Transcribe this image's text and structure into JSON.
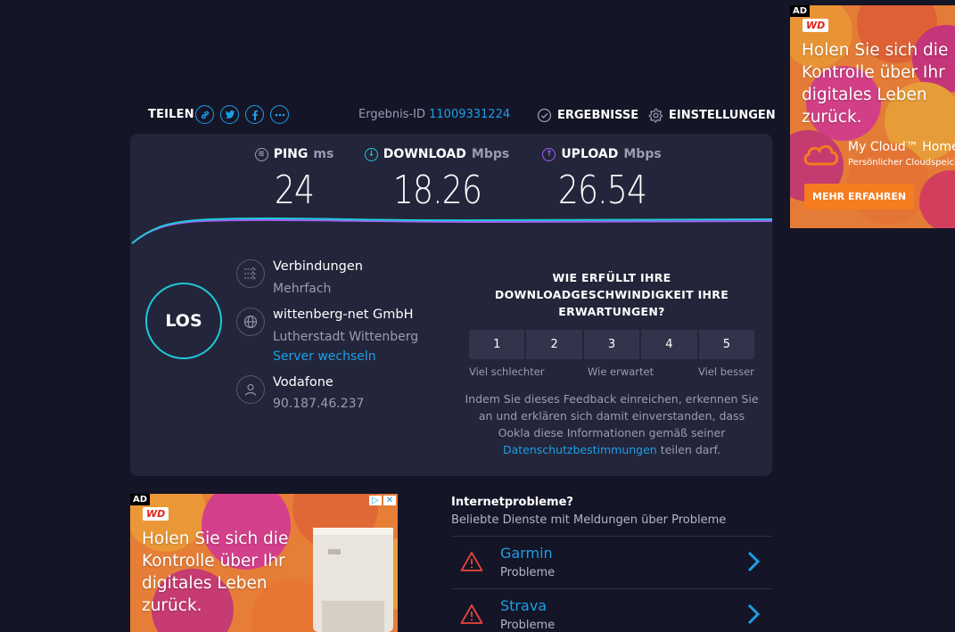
{
  "share": {
    "label": "TEILEN",
    "icons": [
      "link-icon",
      "twitter-icon",
      "facebook-icon",
      "more-icon"
    ]
  },
  "result": {
    "label": "Ergebnis-ID",
    "id": "11009331224"
  },
  "nav": {
    "results_label": "ERGEBNISSE",
    "settings_label": "EINSTELLUNGEN"
  },
  "metrics": {
    "ping": {
      "label": "PING",
      "unit": "ms",
      "value": "24"
    },
    "download": {
      "label": "DOWNLOAD",
      "unit": "Mbps",
      "value": "18.26"
    },
    "upload": {
      "label": "UPLOAD",
      "unit": "Mbps",
      "value": "26.54"
    }
  },
  "go_button": "LOS",
  "connection": {
    "title": "Verbindungen",
    "mode": "Mehrfach"
  },
  "server": {
    "name": "wittenberg-net GmbH",
    "location": "Lutherstadt Wittenberg",
    "change_link": "Server wechseln"
  },
  "provider": {
    "name": "Vodafone",
    "ip": "90.187.46.237"
  },
  "feedback": {
    "question": "WIE ERFÜLLT IHRE DOWNLOADGESCHWINDIGKEIT IHRE ERWARTUNGEN?",
    "ratings": [
      "1",
      "2",
      "3",
      "4",
      "5"
    ],
    "label_low": "Viel schlechter",
    "label_mid": "Wie erwartet",
    "label_high": "Viel besser",
    "disclaimer_1": "Indem Sie dieses Feedback einreichen, erkennen Sie an und erklären sich damit einverstanden, dass Ookla diese Informationen gemäß seiner",
    "privacy_link": "Datenschutzbestimmungen",
    "disclaimer_2": "teilen darf."
  },
  "ad_right": {
    "badge": "AD",
    "brand": "WD",
    "headline": "Holen Sie sich die Kontrolle über Ihr digitales Leben zurück.",
    "product": "My Cloud™ Home",
    "product_sub": "Persönlicher Cloudspeicher",
    "cta": "MEHR ERFAHREN"
  },
  "ad_bottom": {
    "badge": "AD",
    "brand": "WD",
    "headline": "Holen Sie sich die Kontrolle über Ihr digitales Leben zurück."
  },
  "internet_problems": {
    "title": "Internetprobleme?",
    "subtitle": "Beliebte Dienste mit Meldungen über Probleme",
    "items": [
      {
        "name": "Garmin",
        "status": "Probleme"
      },
      {
        "name": "Strava",
        "status": "Probleme"
      }
    ]
  },
  "colors": {
    "background": "#141526",
    "card": "#23253a",
    "accent_blue": "#1c9fe8",
    "download_cyan": "#1ec9d8",
    "upload_purple": "#a35ff5",
    "warning_red": "#e8453c"
  }
}
